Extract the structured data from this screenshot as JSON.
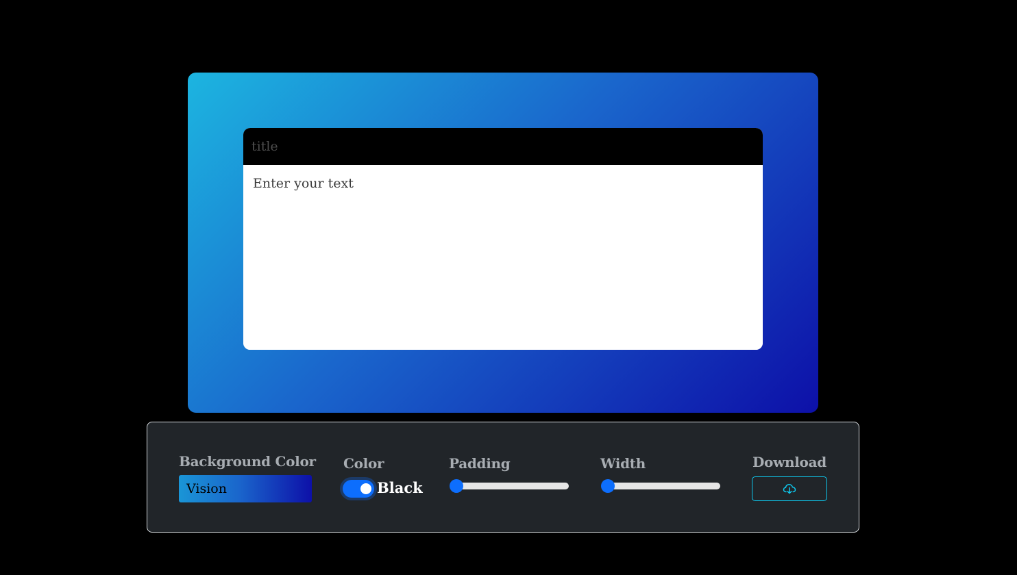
{
  "editor": {
    "title_placeholder": "title",
    "body_placeholder": "Enter your text"
  },
  "controls": {
    "background_color": {
      "label": "Background Color",
      "selected": "Vision"
    },
    "color": {
      "label": "Color",
      "toggle_on": true,
      "value": "Black"
    },
    "padding": {
      "label": "Padding",
      "value_fraction": 0.0
    },
    "width": {
      "label": "Width",
      "value_fraction": 0.0
    },
    "download": {
      "label": "Download",
      "icon": "cloud-download-icon"
    }
  },
  "colors": {
    "page_background": "#000000",
    "gradient_start": "#1cb5e0",
    "gradient_end": "#0d10a8",
    "panel_background": "#212529",
    "accent_blue": "#0d6efd",
    "accent_cyan": "#0dcaf0"
  }
}
